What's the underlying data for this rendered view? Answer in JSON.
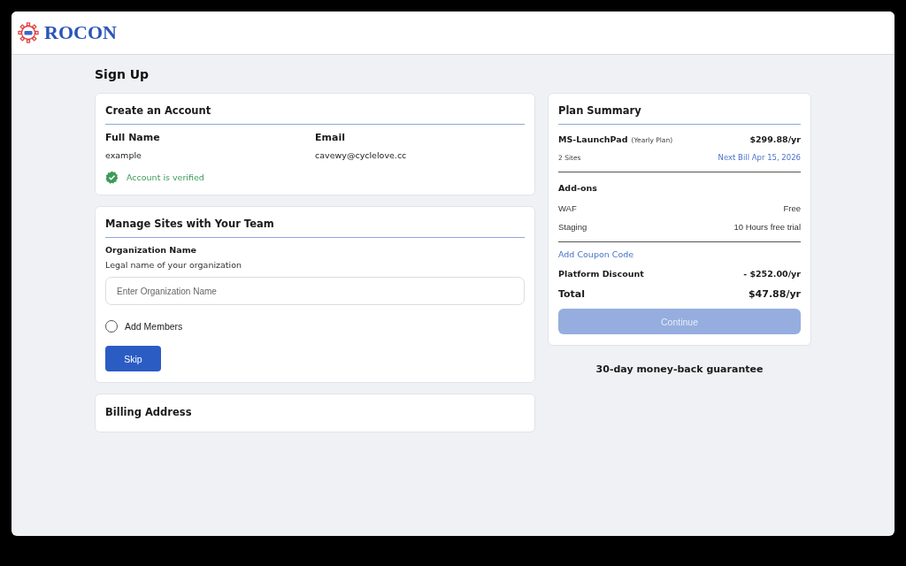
{
  "logo": {
    "text": "ROCON"
  },
  "page_title": "Sign Up",
  "account": {
    "title": "Create an Account",
    "fields": [
      {
        "label": "Full Name",
        "value": "example"
      },
      {
        "label": "Email",
        "value": "cavewy@cyclelove.cc"
      }
    ],
    "verified": true,
    "verified_text": "Account is verified"
  },
  "team": {
    "title": "Manage Sites with Your Team",
    "org_label": "Organization Name",
    "org_hint": "Legal name of your organization",
    "org_placeholder": "Enter Organization Name",
    "add_members": {
      "label": "Add Members",
      "checked": false
    },
    "skip_button": "Skip"
  },
  "billing": {
    "title": "Billing Address"
  },
  "plan": {
    "title": "Plan Summary",
    "name": "MS-LaunchPad",
    "period": "(Yearly Plan)",
    "price": "$299.88/yr",
    "sites": "2 Sites",
    "next_bill": "Next Bill Apr 15, 2026",
    "addons_title": "Add-ons",
    "addons": [
      {
        "name": "WAF",
        "value": "Free"
      },
      {
        "name": "Staging",
        "value": "10 Hours free trial"
      }
    ],
    "coupon_link": "Add Coupon Code",
    "discount_label": "Platform Discount",
    "discount_value": "- $252.00/yr",
    "total_label": "Total",
    "total_value": "$47.88/yr",
    "continue": {
      "label": "Continue",
      "disabled": true
    }
  },
  "guarantee": "30-day money-back guarantee"
}
